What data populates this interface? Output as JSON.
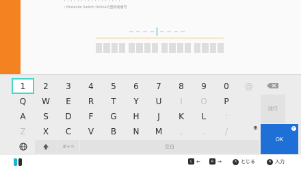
{
  "colors": {
    "accent": "#f58220",
    "selection": "#43d9c9",
    "ok": "#1e6fd6"
  },
  "header": {
    "line1": "・・・・・・・・・・・・・・・・・",
    "line2": "・Nintendo Switch Onlineの登録用番号"
  },
  "keyboard": {
    "row1": [
      "1",
      "2",
      "3",
      "4",
      "5",
      "6",
      "7",
      "8",
      "9",
      "0",
      "@"
    ],
    "row2": [
      "Q",
      "W",
      "E",
      "R",
      "T",
      "Y",
      "U",
      "I",
      "O",
      "P"
    ],
    "row3": [
      "A",
      "S",
      "D",
      "F",
      "G",
      "H",
      "J",
      "K",
      "L",
      ":"
    ],
    "row4": [
      "Z",
      "X",
      "C",
      "V",
      "B",
      "N",
      "M",
      ",",
      ".",
      "/"
    ],
    "backspace_icon": "backspace-icon",
    "newline_label": "改行",
    "ok_label": "OK",
    "symbols_label": "#+=",
    "space_label": "空白",
    "globe_icon": "globe-icon",
    "shift_icon": "shift-icon"
  },
  "footer": {
    "hints": [
      {
        "button": "L",
        "label": "←"
      },
      {
        "button": "R",
        "label": "→"
      },
      {
        "button": "X",
        "label": "とじる"
      },
      {
        "button": "A",
        "label": "入力"
      }
    ]
  }
}
